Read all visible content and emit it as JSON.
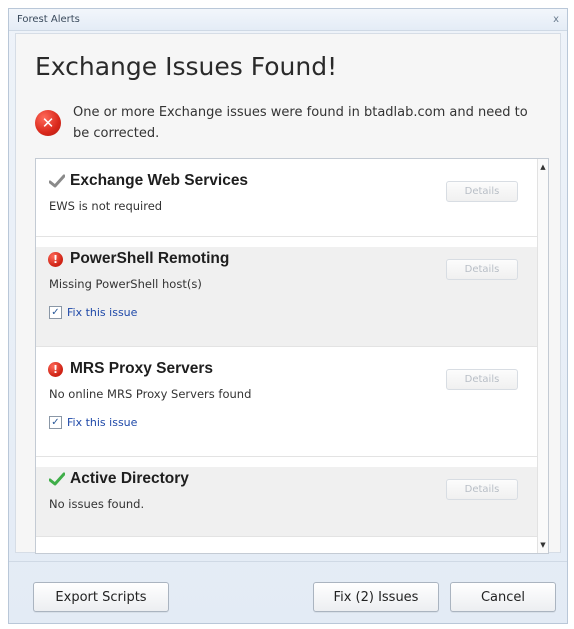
{
  "window": {
    "title": "Forest Alerts",
    "close_glyph": "x"
  },
  "heading": "Exchange Issues Found!",
  "alert": {
    "icon": "error-icon",
    "message": "One or more Exchange issues were found in btadlab.com and need to be corrected."
  },
  "items": [
    {
      "title": "Exchange Web Services",
      "status": "ok-gray",
      "description": "EWS is not required",
      "details_label": "Details",
      "fix": null
    },
    {
      "title": "PowerShell Remoting",
      "status": "error",
      "description": "Missing PowerShell host(s)",
      "details_label": "Details",
      "fix": {
        "label": "Fix this issue",
        "checked": true
      }
    },
    {
      "title": "MRS Proxy Servers",
      "status": "error",
      "description": "No online MRS Proxy Servers found",
      "details_label": "Details",
      "fix": {
        "label": "Fix this issue",
        "checked": true
      }
    },
    {
      "title": "Active Directory",
      "status": "ok-green",
      "description": "No issues found.",
      "details_label": "Details",
      "fix": null
    }
  ],
  "buttons": {
    "export": "Export Scripts",
    "fix": "Fix (2) Issues",
    "cancel": "Cancel"
  },
  "colors": {
    "error_red": "#d9281b",
    "ok_green": "#3fae49",
    "ok_gray": "#8a8a8a",
    "link_blue": "#1e48a8"
  }
}
